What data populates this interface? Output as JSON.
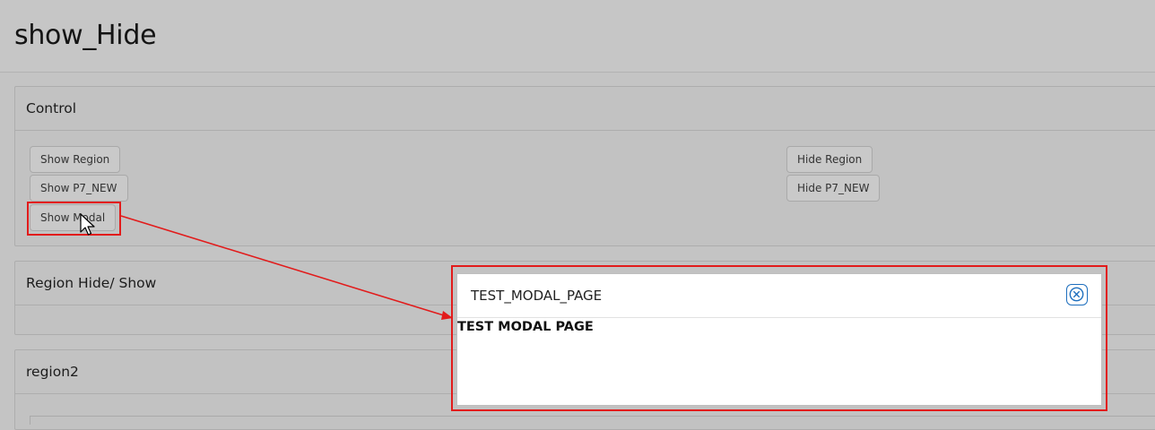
{
  "page": {
    "title": "show_Hide"
  },
  "regions": {
    "control": {
      "title": "Control",
      "buttons": {
        "show_region": "Show Region",
        "show_p7_new": "Show P7_NEW",
        "show_modal": "Show Modal",
        "hide_region": "Hide Region",
        "hide_p7_new": "Hide P7_NEW"
      }
    },
    "region_hide_show": {
      "title": "Region Hide/ Show"
    },
    "region2": {
      "title": "region2"
    }
  },
  "modal": {
    "title": "TEST_MODAL_PAGE",
    "body_text": "TEST MODAL PAGE",
    "close_icon": "close-icon"
  },
  "annotations": {
    "highlight_color": "#e21b1b",
    "close_button_color": "#1e6fbe"
  }
}
